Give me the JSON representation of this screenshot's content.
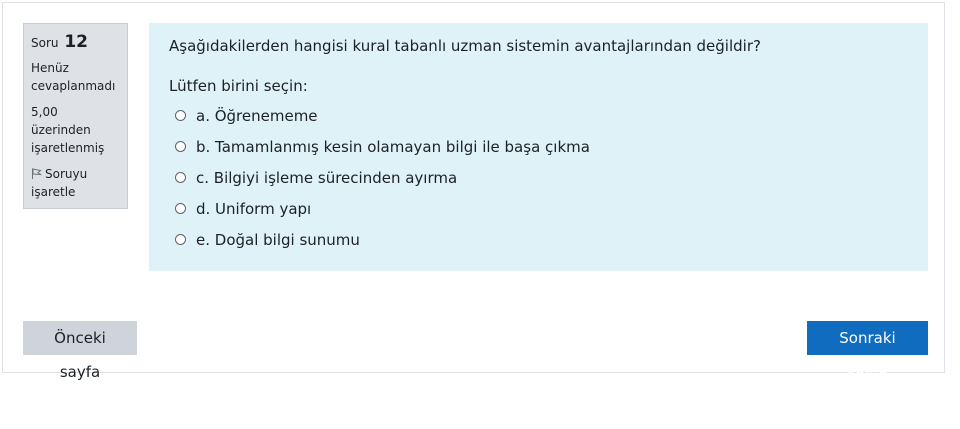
{
  "question_info": {
    "number_label": "Soru",
    "number": "12",
    "state": "Henüz cevaplanmadı",
    "grade": "5,00 üzerinden işaretlenmiş",
    "flag_label": "Soruyu işaretle"
  },
  "question": {
    "text": "Aşağıdakilerden hangisi kural tabanlı uzman sistemin avantajlarından değildir?",
    "prompt": "Lütfen birini seçin:",
    "answers": [
      {
        "label": "a. Öğrenememe"
      },
      {
        "label": "b. Tamamlanmış kesin olamayan bilgi ile başa çıkma"
      },
      {
        "label": "c. Bilgiyi işleme sürecinden ayırma"
      },
      {
        "label": "d. Uniform yapı"
      },
      {
        "label": "e. Doğal bilgi sunumu"
      }
    ]
  },
  "navigation": {
    "prev_label": "Önceki sayfa",
    "next_label": "Sonraki sayfa"
  },
  "colors": {
    "content_bg": "#def2f8",
    "info_bg": "#dee2e6",
    "primary": "#0f6cbf",
    "secondary": "#ced4da"
  },
  "icons": {
    "flag": "flag-icon",
    "radio": "radio-unchecked-icon"
  }
}
